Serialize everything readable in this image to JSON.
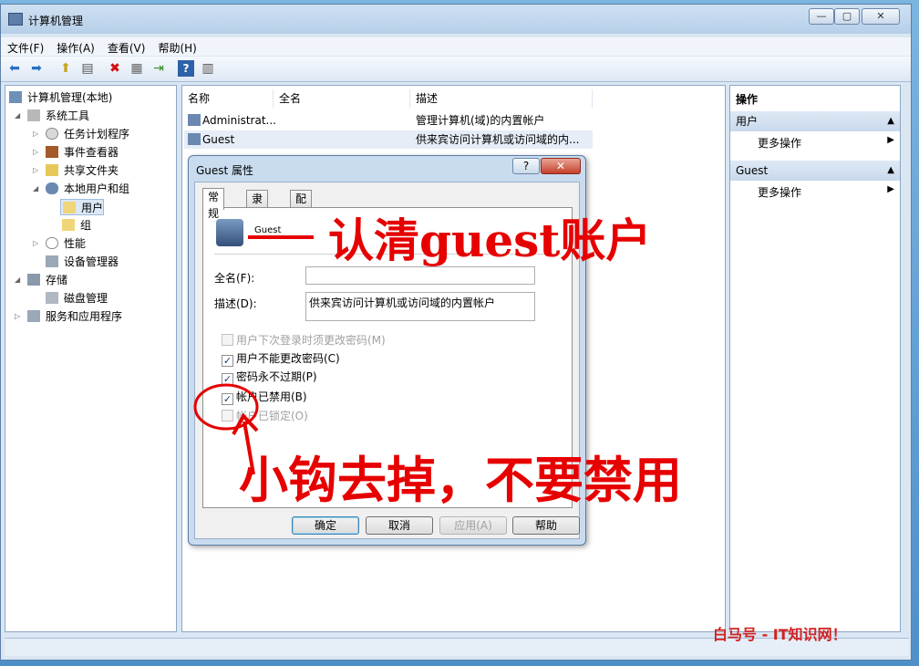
{
  "window": {
    "title": "计算机管理",
    "min": "—",
    "max": "▢",
    "close": "✕"
  },
  "menu": [
    "文件(F)",
    "操作(A)",
    "查看(V)",
    "帮助(H)"
  ],
  "tree": {
    "root": "计算机管理(本地)",
    "system_tools": "系统工具",
    "task_scheduler": "任务计划程序",
    "event_viewer": "事件查看器",
    "shared_folders": "共享文件夹",
    "local_users": "本地用户和组",
    "users": "用户",
    "groups": "组",
    "performance": "性能",
    "device_manager": "设备管理器",
    "storage": "存储",
    "disk_mgmt": "磁盘管理",
    "services": "服务和应用程序"
  },
  "list": {
    "headers": [
      "名称",
      "全名",
      "描述"
    ],
    "rows": [
      {
        "name": "Administrat...",
        "fullname": "",
        "desc": "管理计算机(域)的内置帐户"
      },
      {
        "name": "Guest",
        "fullname": "",
        "desc": "供来宾访问计算机或访问域的内..."
      }
    ]
  },
  "actions": {
    "header": "操作",
    "group1": "用户",
    "more1": "更多操作",
    "group2": "Guest",
    "more2": "更多操作"
  },
  "dialog": {
    "title": "Guest 属性",
    "help": "?",
    "close": "✕",
    "tabs": [
      "常规",
      "隶属于",
      "配置文件"
    ],
    "username": "Guest",
    "fullname_label": "全名(F):",
    "fullname_value": "",
    "desc_label": "描述(D):",
    "desc_value": "供来宾访问计算机或访问域的内置帐户",
    "cb1": "用户下次登录时须更改密码(M)",
    "cb2": "用户不能更改密码(C)",
    "cb3": "密码永不过期(P)",
    "cb4": "帐户已禁用(B)",
    "cb5": "帐户已锁定(O)",
    "ok": "确定",
    "cancel": "取消",
    "apply": "应用(A)",
    "helpbtn": "帮助"
  },
  "annotations": {
    "a1": "认清guest账户",
    "a2": "小钩去掉，不要禁用"
  },
  "watermark": "白马号 - IT知识网！",
  "colors": {
    "annotation": "#e60000",
    "title_bg": "#b6cfe8",
    "close_btn": "#c4412b"
  }
}
